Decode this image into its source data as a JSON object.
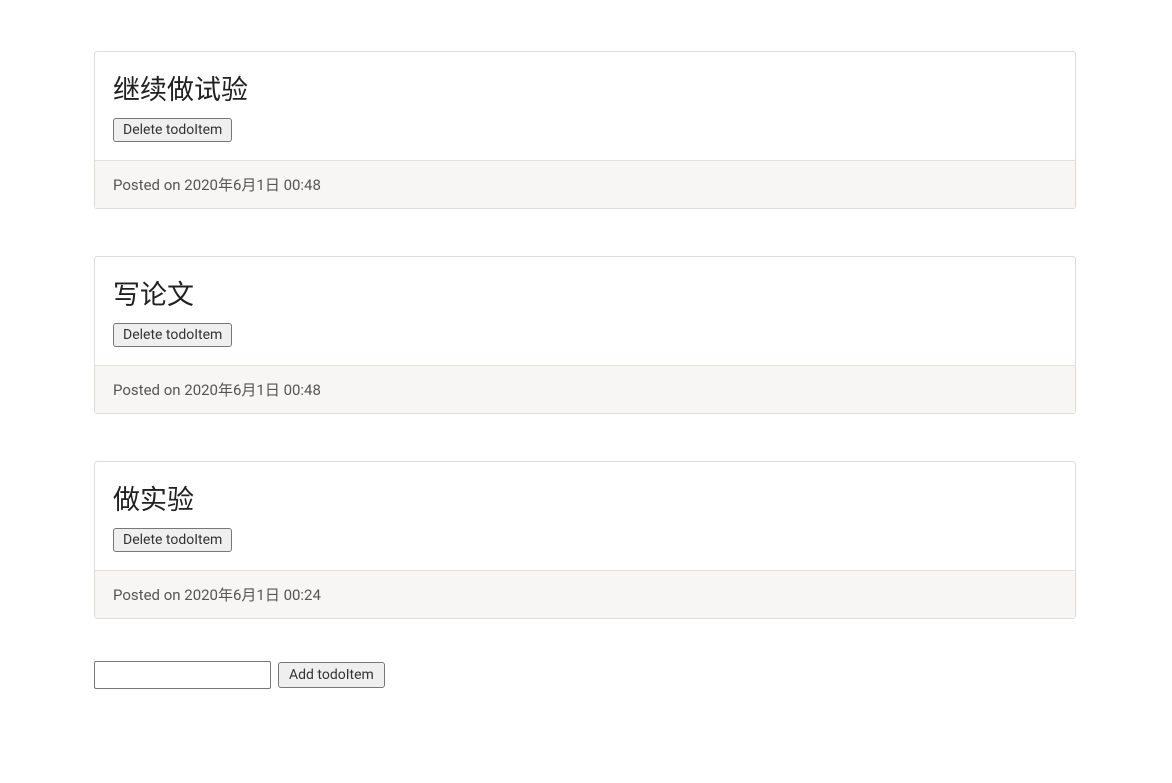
{
  "todos": [
    {
      "title": "继续做试验",
      "deleteLabel": "Delete todoItem",
      "postedPrefix": "Posted on ",
      "postedDate": "2020年6月1日 00:48"
    },
    {
      "title": "写论文",
      "deleteLabel": "Delete todoItem",
      "postedPrefix": "Posted on ",
      "postedDate": "2020年6月1日 00:48"
    },
    {
      "title": "做实验",
      "deleteLabel": "Delete todoItem",
      "postedPrefix": "Posted on ",
      "postedDate": "2020年6月1日 00:24"
    }
  ],
  "addForm": {
    "inputValue": "",
    "addLabel": "Add todoItem"
  }
}
